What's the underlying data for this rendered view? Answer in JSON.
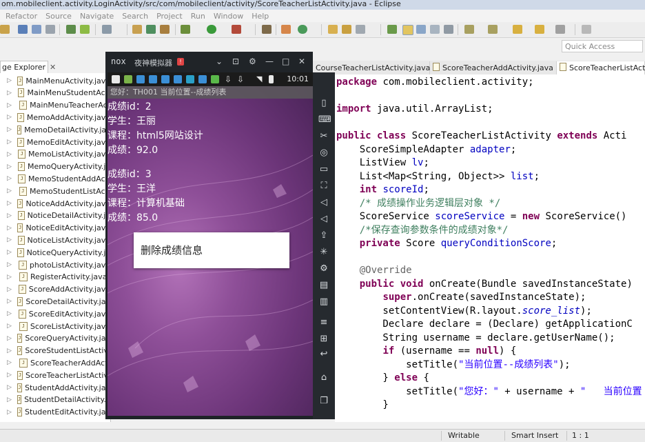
{
  "window": {
    "title": "om.mobileclient.activity.LoginActivity/src/com/mobileclient/activity/ScoreTeacherListActivity.java - Eclipse"
  },
  "menu": [
    "Refactor",
    "Source",
    "Navigate",
    "Search",
    "Project",
    "Run",
    "Window",
    "Help"
  ],
  "quick_access": {
    "placeholder": "Quick Access"
  },
  "package_explorer": {
    "tab_label": "ge Explorer",
    "close": "✕",
    "files": [
      "MainMenuActivity.java",
      "MainMenuStudentActi",
      "MainMenuTeacherAct",
      "MemoAddActivity.java",
      "MemoDetailActivity.java",
      "MemoEditActivity.java",
      "MemoListActivity.java",
      "MemoQueryActivity.ja",
      "MemoStudentAddActi",
      "MemoStudentListActi",
      "NoticeAddActivity.java",
      "NoticeDetailActivity.ja",
      "NoticeEditActivity.java",
      "NoticeListActivity.java",
      "NoticeQueryActivity.ja",
      "photoListActivity.java",
      "RegisterActivity.java",
      "ScoreAddActivity.java",
      "ScoreDetailActivity.jav",
      "ScoreEditActivity.java",
      "ScoreListActivity.java",
      "ScoreQueryActivity.jav",
      "ScoreStudentListActivi",
      "ScoreTeacherAddActi",
      "ScoreTeacherListActivi",
      "StudentAddActivity.jav",
      "StudentDetailActivity.ja",
      "StudentEditActivity.jav"
    ]
  },
  "editor_tabs": [
    "CourseTeacherListActivity.java",
    "ScoreTeacherAddActivity.java",
    "ScoreTeacherListActivi"
  ],
  "emulator": {
    "logo": "nox",
    "name": "夜神模拟器",
    "badge": "!",
    "controls": [
      "⌄",
      "⊡",
      "⚙",
      "—",
      "□",
      "✕"
    ],
    "time": "10:01",
    "app_bar": "您好：TH001   当前位置--成绩列表",
    "records": [
      [
        "成绩id：2",
        "学生：王丽",
        "课程：html5网站设计",
        "成绩：92.0"
      ],
      [
        "成绩id：3",
        "学生：王洋",
        "课程：计算机基础",
        "成绩：85.0"
      ]
    ],
    "dialog": "删除成绩信息"
  },
  "code": [
    [
      {
        "c": "kw",
        "t": "package"
      },
      {
        "c": "",
        "t": " com.mobileclient.activity;"
      }
    ],
    [],
    [
      {
        "c": "kw",
        "t": "import"
      },
      {
        "c": "",
        "t": " java.util.ArrayList;"
      }
    ],
    [],
    [
      {
        "c": "kw",
        "t": "public class"
      },
      {
        "c": "",
        "t": " ScoreTeacherListActivity "
      },
      {
        "c": "kw",
        "t": "extends"
      },
      {
        "c": "",
        "t": " Acti"
      }
    ],
    [
      {
        "c": "",
        "t": "    ScoreSimpleAdapter "
      },
      {
        "c": "fd",
        "t": "adapter"
      },
      {
        "c": "",
        "t": ";"
      }
    ],
    [
      {
        "c": "",
        "t": "    ListView "
      },
      {
        "c": "fd",
        "t": "lv"
      },
      {
        "c": "",
        "t": ";"
      }
    ],
    [
      {
        "c": "",
        "t": "    List<Map<String, Object>> "
      },
      {
        "c": "fd",
        "t": "list"
      },
      {
        "c": "",
        "t": ";"
      }
    ],
    [
      {
        "c": "",
        "t": "    "
      },
      {
        "c": "kw",
        "t": "int"
      },
      {
        "c": "",
        "t": " "
      },
      {
        "c": "fd",
        "t": "scoreId"
      },
      {
        "c": "",
        "t": ";"
      }
    ],
    [
      {
        "c": "cm",
        "t": "    /* 成绩操作业务逻辑层对象 */"
      }
    ],
    [
      {
        "c": "",
        "t": "    ScoreService "
      },
      {
        "c": "fd",
        "t": "scoreService"
      },
      {
        "c": "",
        "t": " = "
      },
      {
        "c": "kw",
        "t": "new"
      },
      {
        "c": "",
        "t": " ScoreService()"
      }
    ],
    [
      {
        "c": "cm",
        "t": "    /*保存查询参数条件的成绩对象*/"
      }
    ],
    [
      {
        "c": "",
        "t": "    "
      },
      {
        "c": "kw",
        "t": "private"
      },
      {
        "c": "",
        "t": " Score "
      },
      {
        "c": "fd",
        "t": "queryConditionScore"
      },
      {
        "c": "",
        "t": ";"
      }
    ],
    [],
    [
      {
        "c": "an",
        "t": "    @Override"
      }
    ],
    [
      {
        "c": "",
        "t": "    "
      },
      {
        "c": "kw",
        "t": "public void"
      },
      {
        "c": "",
        "t": " onCreate(Bundle savedInstanceState)"
      }
    ],
    [
      {
        "c": "",
        "t": "        "
      },
      {
        "c": "kw",
        "t": "super"
      },
      {
        "c": "",
        "t": ".onCreate(savedInstanceState);"
      }
    ],
    [
      {
        "c": "",
        "t": "        setContentView(R.layout."
      },
      {
        "c": "it",
        "t": "score_list"
      },
      {
        "c": "",
        "t": ");"
      }
    ],
    [
      {
        "c": "",
        "t": "        Declare declare = (Declare) getApplicationC"
      }
    ],
    [
      {
        "c": "",
        "t": "        String username = declare.getUserName();"
      }
    ],
    [
      {
        "c": "",
        "t": "        "
      },
      {
        "c": "kw",
        "t": "if"
      },
      {
        "c": "",
        "t": " (username == "
      },
      {
        "c": "kw",
        "t": "null"
      },
      {
        "c": "",
        "t": ") {"
      }
    ],
    [
      {
        "c": "",
        "t": "            setTitle("
      },
      {
        "c": "st",
        "t": "\"当前位置--成绩列表\""
      },
      {
        "c": "",
        "t": ");"
      }
    ],
    [
      {
        "c": "",
        "t": "        } "
      },
      {
        "c": "kw",
        "t": "else"
      },
      {
        "c": "",
        "t": " {"
      }
    ],
    [
      {
        "c": "",
        "t": "            setTitle("
      },
      {
        "c": "st",
        "t": "\"您好：\""
      },
      {
        "c": "",
        "t": " + username + "
      },
      {
        "c": "st",
        "t": "\"   当前位置"
      }
    ],
    [
      {
        "c": "",
        "t": "        }"
      }
    ]
  ],
  "status": {
    "mode": "Writable",
    "insert": "Smart Insert",
    "position": "1 : 1"
  },
  "colors": {
    "keyword": "#7f0055",
    "field": "#0000c0",
    "comment": "#3f7f5f",
    "string": "#2a00ff"
  }
}
